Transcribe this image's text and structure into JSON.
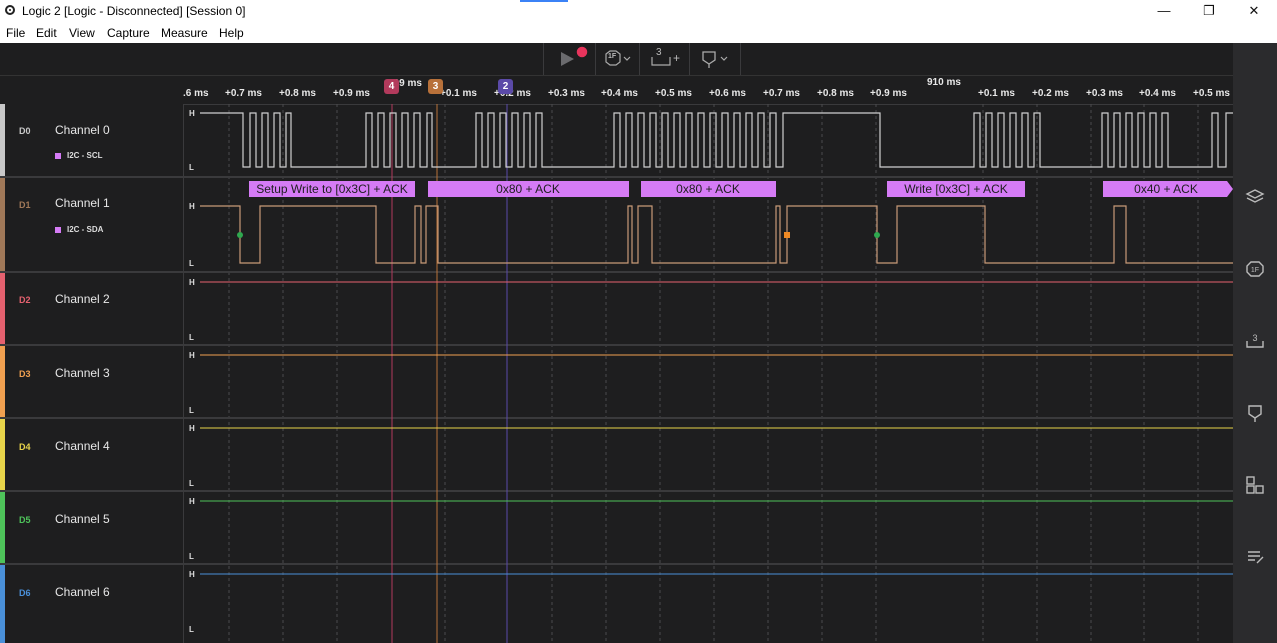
{
  "window": {
    "title": "Logic 2 [Logic - Disconnected] [Session 0]",
    "minimize_glyph": "—",
    "maximize_glyph": "❐",
    "close_glyph": "✕"
  },
  "menu": [
    {
      "label": "File"
    },
    {
      "label": "Edit"
    },
    {
      "label": "View"
    },
    {
      "label": "Capture"
    },
    {
      "label": "Measure"
    },
    {
      "label": "Help"
    }
  ],
  "toolbar": {
    "start_icon": "play-icon",
    "trigger_label": "1F",
    "measure_label": "3",
    "measure_plus": "+",
    "colors": {
      "record": "#e8345c"
    }
  },
  "ruler": {
    "ticks": [
      ".6 ms",
      "+0.7 ms",
      "+0.8 ms",
      "+0.9 ms",
      "909 ms",
      "+0.1 ms",
      "+0.2 ms",
      "+0.3 ms",
      "+0.4 ms",
      "+0.5 ms",
      "+0.6 ms",
      "+0.7 ms",
      "+0.8 ms",
      "+0.9 ms",
      "910 ms",
      "+0.1 ms",
      "+0.2 ms",
      "+0.3 ms",
      "+0.4 ms",
      "+0.5 ms"
    ],
    "major_label": "910 ms",
    "markers": [
      {
        "label": "4",
        "color": "#b23a5c"
      },
      {
        "label": "3",
        "color": "#b8713a"
      },
      {
        "label": "2",
        "color": "#5b4aa8"
      }
    ]
  },
  "channels": [
    {
      "id": "D0",
      "name": "Channel 0",
      "color": "#c8c8c8",
      "analyzer": "I2C - SCL",
      "high": "H",
      "low": "L"
    },
    {
      "id": "D1",
      "name": "Channel 1",
      "color": "#a07858",
      "analyzer": "I2C - SDA",
      "high": "H",
      "low": "L"
    },
    {
      "id": "D2",
      "name": "Channel 2",
      "color": "#e5616f",
      "high": "H",
      "low": "L"
    },
    {
      "id": "D3",
      "name": "Channel 3",
      "color": "#f0a050",
      "high": "H",
      "low": "L"
    },
    {
      "id": "D4",
      "name": "Channel 4",
      "color": "#e8d44a",
      "high": "H",
      "low": "L"
    },
    {
      "id": "D5",
      "name": "Channel 5",
      "color": "#4ec35a",
      "high": "H",
      "low": "L"
    },
    {
      "id": "D6",
      "name": "Channel 6",
      "color": "#4a90d9",
      "high": "H",
      "low": "L"
    }
  ],
  "i2c_frames": [
    {
      "label": "Setup Write to [0x3C] + ACK"
    },
    {
      "label": "0x80 + ACK"
    },
    {
      "label": "0x80 + ACK"
    },
    {
      "label": "Write [0x3C] + ACK"
    },
    {
      "label": "0x40 + ACK"
    }
  ],
  "frame_color": "#d57bf5",
  "sidebar_icons": [
    "analyzers-icon",
    "trigger-icon",
    "measure-icon",
    "marker-icon",
    "extensions-icon",
    "notes-icon"
  ]
}
